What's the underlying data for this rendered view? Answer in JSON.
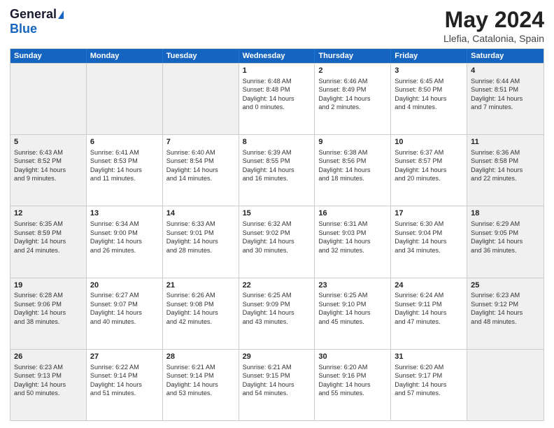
{
  "header": {
    "logo_general": "General",
    "logo_blue": "Blue",
    "month_title": "May 2024",
    "location": "Llefia, Catalonia, Spain"
  },
  "days_of_week": [
    "Sunday",
    "Monday",
    "Tuesday",
    "Wednesday",
    "Thursday",
    "Friday",
    "Saturday"
  ],
  "rows": [
    [
      {
        "day": "",
        "info": "",
        "shaded": true
      },
      {
        "day": "",
        "info": "",
        "shaded": true
      },
      {
        "day": "",
        "info": "",
        "shaded": true
      },
      {
        "day": "1",
        "info": "Sunrise: 6:48 AM\nSunset: 8:48 PM\nDaylight: 14 hours\nand 0 minutes.",
        "shaded": false
      },
      {
        "day": "2",
        "info": "Sunrise: 6:46 AM\nSunset: 8:49 PM\nDaylight: 14 hours\nand 2 minutes.",
        "shaded": false
      },
      {
        "day": "3",
        "info": "Sunrise: 6:45 AM\nSunset: 8:50 PM\nDaylight: 14 hours\nand 4 minutes.",
        "shaded": false
      },
      {
        "day": "4",
        "info": "Sunrise: 6:44 AM\nSunset: 8:51 PM\nDaylight: 14 hours\nand 7 minutes.",
        "shaded": true
      }
    ],
    [
      {
        "day": "5",
        "info": "Sunrise: 6:43 AM\nSunset: 8:52 PM\nDaylight: 14 hours\nand 9 minutes.",
        "shaded": true
      },
      {
        "day": "6",
        "info": "Sunrise: 6:41 AM\nSunset: 8:53 PM\nDaylight: 14 hours\nand 11 minutes.",
        "shaded": false
      },
      {
        "day": "7",
        "info": "Sunrise: 6:40 AM\nSunset: 8:54 PM\nDaylight: 14 hours\nand 14 minutes.",
        "shaded": false
      },
      {
        "day": "8",
        "info": "Sunrise: 6:39 AM\nSunset: 8:55 PM\nDaylight: 14 hours\nand 16 minutes.",
        "shaded": false
      },
      {
        "day": "9",
        "info": "Sunrise: 6:38 AM\nSunset: 8:56 PM\nDaylight: 14 hours\nand 18 minutes.",
        "shaded": false
      },
      {
        "day": "10",
        "info": "Sunrise: 6:37 AM\nSunset: 8:57 PM\nDaylight: 14 hours\nand 20 minutes.",
        "shaded": false
      },
      {
        "day": "11",
        "info": "Sunrise: 6:36 AM\nSunset: 8:58 PM\nDaylight: 14 hours\nand 22 minutes.",
        "shaded": true
      }
    ],
    [
      {
        "day": "12",
        "info": "Sunrise: 6:35 AM\nSunset: 8:59 PM\nDaylight: 14 hours\nand 24 minutes.",
        "shaded": true
      },
      {
        "day": "13",
        "info": "Sunrise: 6:34 AM\nSunset: 9:00 PM\nDaylight: 14 hours\nand 26 minutes.",
        "shaded": false
      },
      {
        "day": "14",
        "info": "Sunrise: 6:33 AM\nSunset: 9:01 PM\nDaylight: 14 hours\nand 28 minutes.",
        "shaded": false
      },
      {
        "day": "15",
        "info": "Sunrise: 6:32 AM\nSunset: 9:02 PM\nDaylight: 14 hours\nand 30 minutes.",
        "shaded": false
      },
      {
        "day": "16",
        "info": "Sunrise: 6:31 AM\nSunset: 9:03 PM\nDaylight: 14 hours\nand 32 minutes.",
        "shaded": false
      },
      {
        "day": "17",
        "info": "Sunrise: 6:30 AM\nSunset: 9:04 PM\nDaylight: 14 hours\nand 34 minutes.",
        "shaded": false
      },
      {
        "day": "18",
        "info": "Sunrise: 6:29 AM\nSunset: 9:05 PM\nDaylight: 14 hours\nand 36 minutes.",
        "shaded": true
      }
    ],
    [
      {
        "day": "19",
        "info": "Sunrise: 6:28 AM\nSunset: 9:06 PM\nDaylight: 14 hours\nand 38 minutes.",
        "shaded": true
      },
      {
        "day": "20",
        "info": "Sunrise: 6:27 AM\nSunset: 9:07 PM\nDaylight: 14 hours\nand 40 minutes.",
        "shaded": false
      },
      {
        "day": "21",
        "info": "Sunrise: 6:26 AM\nSunset: 9:08 PM\nDaylight: 14 hours\nand 42 minutes.",
        "shaded": false
      },
      {
        "day": "22",
        "info": "Sunrise: 6:25 AM\nSunset: 9:09 PM\nDaylight: 14 hours\nand 43 minutes.",
        "shaded": false
      },
      {
        "day": "23",
        "info": "Sunrise: 6:25 AM\nSunset: 9:10 PM\nDaylight: 14 hours\nand 45 minutes.",
        "shaded": false
      },
      {
        "day": "24",
        "info": "Sunrise: 6:24 AM\nSunset: 9:11 PM\nDaylight: 14 hours\nand 47 minutes.",
        "shaded": false
      },
      {
        "day": "25",
        "info": "Sunrise: 6:23 AM\nSunset: 9:12 PM\nDaylight: 14 hours\nand 48 minutes.",
        "shaded": true
      }
    ],
    [
      {
        "day": "26",
        "info": "Sunrise: 6:23 AM\nSunset: 9:13 PM\nDaylight: 14 hours\nand 50 minutes.",
        "shaded": true
      },
      {
        "day": "27",
        "info": "Sunrise: 6:22 AM\nSunset: 9:14 PM\nDaylight: 14 hours\nand 51 minutes.",
        "shaded": false
      },
      {
        "day": "28",
        "info": "Sunrise: 6:21 AM\nSunset: 9:14 PM\nDaylight: 14 hours\nand 53 minutes.",
        "shaded": false
      },
      {
        "day": "29",
        "info": "Sunrise: 6:21 AM\nSunset: 9:15 PM\nDaylight: 14 hours\nand 54 minutes.",
        "shaded": false
      },
      {
        "day": "30",
        "info": "Sunrise: 6:20 AM\nSunset: 9:16 PM\nDaylight: 14 hours\nand 55 minutes.",
        "shaded": false
      },
      {
        "day": "31",
        "info": "Sunrise: 6:20 AM\nSunset: 9:17 PM\nDaylight: 14 hours\nand 57 minutes.",
        "shaded": false
      },
      {
        "day": "",
        "info": "",
        "shaded": true
      }
    ]
  ]
}
